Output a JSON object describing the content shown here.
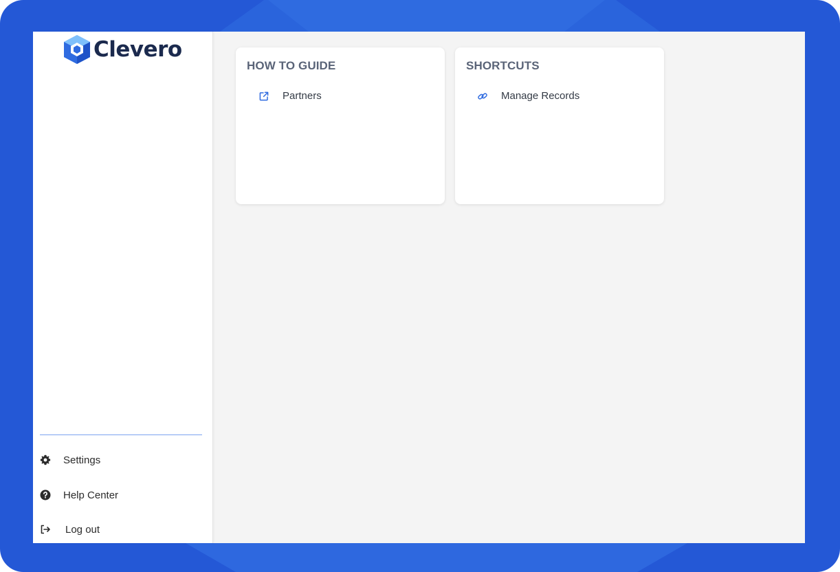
{
  "brand": {
    "name": "Clevero",
    "logo_icon": "clevero-cube-icon",
    "accent": "#2f6be0",
    "text_color": "#1b2a4e"
  },
  "sidebar": {
    "footer_items": [
      {
        "label": "Settings",
        "icon": "gear-icon"
      },
      {
        "label": "Help Center",
        "icon": "question-circle-icon"
      },
      {
        "label": "Log out",
        "icon": "logout-icon"
      }
    ]
  },
  "cards": {
    "guide": {
      "title": "HOW TO GUIDE",
      "links": [
        {
          "label": "Partners",
          "icon": "external-link-icon"
        }
      ]
    },
    "shortcuts": {
      "title": "SHORTCUTS",
      "links": [
        {
          "label": "Manage Records",
          "icon": "link-icon"
        }
      ]
    }
  },
  "colors": {
    "frame": "#2458d6",
    "frame_highlight": "#2f6be0",
    "content_bg": "#f4f4f4",
    "icon_blue": "#2f6be0",
    "divider": "#7ba3ef"
  }
}
